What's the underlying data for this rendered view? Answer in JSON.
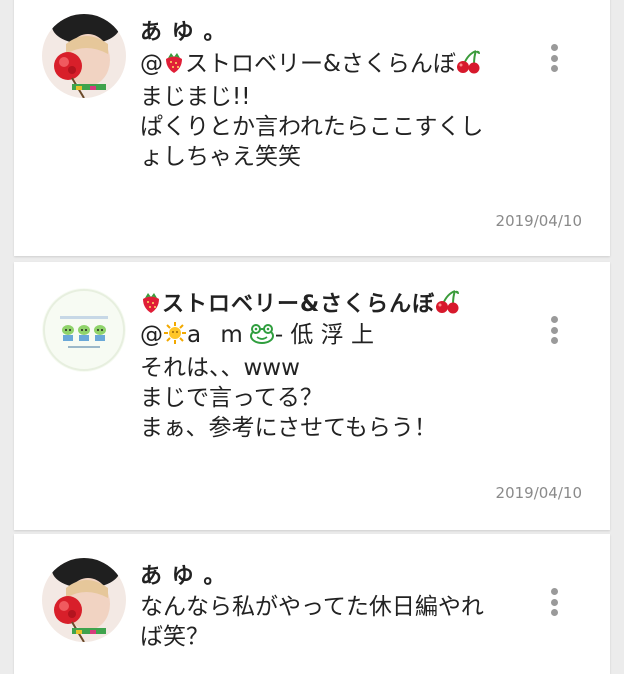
{
  "posts": [
    {
      "author": "あ ゆ 。",
      "mention_prefix": "@",
      "mention_name": "ストロベリー&さくらんぼ",
      "lines": [
        "まじまじ!!",
        "ぱくりとか言われたらここすくし",
        "ょしちゃえ笑笑"
      ],
      "date": "2019/04/10",
      "avatar": "girl-with-red-flower-avatar"
    },
    {
      "author": "ストロベリー&さくらんぼ",
      "mention_prefix": "@",
      "mention_part1": "a m",
      "mention_part2": "- 低 浮 上",
      "lines": [
        "それは、、www",
        "まじで言ってる？",
        "まぁ、参考にさせてもらう！"
      ],
      "date": "2019/04/10",
      "avatar": "three-aliens-avatar"
    },
    {
      "author": "あ ゆ 。",
      "lines": [
        "なんなら私がやってた休日編やれ",
        "ば笑？"
      ],
      "avatar": "girl-with-red-flower-avatar"
    }
  ],
  "colors": {
    "background": "#ececec",
    "card": "#ffffff",
    "text": "#222222",
    "date": "#8a8a8a",
    "more_dots": "#9a9a9a"
  }
}
